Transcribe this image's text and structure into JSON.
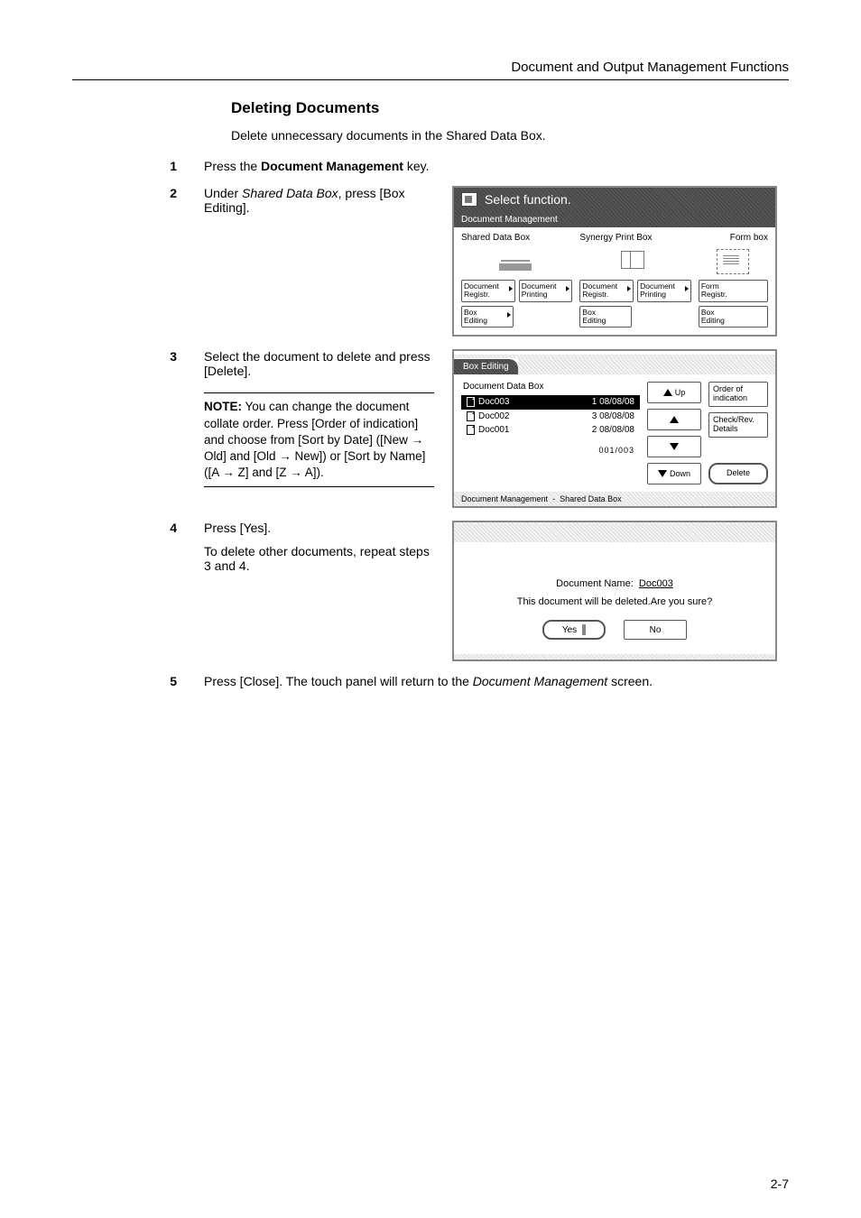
{
  "header": "Document and Output Management Functions",
  "title": "Deleting Documents",
  "intro": "Delete unnecessary documents in the Shared Data Box.",
  "steps": {
    "s1": {
      "n": "1",
      "pre": "Press the ",
      "bold": "Document Management",
      "post": " key."
    },
    "s2": {
      "n": "2",
      "pre": "Under ",
      "ital": "Shared Data Box",
      "post": ", press [Box Editing]."
    },
    "s3": {
      "n": "3",
      "text": "Select the document to delete and press [Delete]."
    },
    "s4": {
      "n": "4",
      "text": "Press [Yes].",
      "text2": "To delete other documents, repeat steps 3 and 4."
    },
    "s5": {
      "n": "5",
      "pre": "Press [Close]. The touch panel will return to the ",
      "ital": "Document Management",
      "post": " screen."
    }
  },
  "note": {
    "label": "NOTE:",
    "body": "You can change the document collate order. Press [Order of indication] and choose from [Sort by Date] ([New → Old] and [Old → New]) or [Sort by Name] ([A → Z] and [Z → A])."
  },
  "panel1": {
    "title": "Select function.",
    "sub": "Document Management",
    "col1": {
      "h": "Shared Data Box",
      "b1": "Document\nRegistr.",
      "b2": "Document\nPrinting",
      "b3": "Box\nEditing"
    },
    "col2": {
      "h": "Synergy Print Box",
      "b1": "Document\nRegistr.",
      "b2": "Document\nPrinting",
      "b3": "Box\nEditing"
    },
    "col3": {
      "h": "Form box",
      "b1": "Form\nRegistr.",
      "b3": "Box\nEditing"
    }
  },
  "panel2": {
    "tab": "Box Editing",
    "list_head": "Document Data Box",
    "rows": [
      {
        "name": "Doc003",
        "num": "1",
        "date": "08/08/08"
      },
      {
        "name": "Doc002",
        "num": "3",
        "date": "08/08/08"
      },
      {
        "name": "Doc001",
        "num": "2",
        "date": "08/08/08"
      }
    ],
    "counter": "001/003",
    "up": "Up",
    "down": "Down",
    "order": "Order of\nindication",
    "check": "Check/Rev.\nDetails",
    "delete": "Delete",
    "bc1": "Document Management",
    "bc2": "Shared Data Box"
  },
  "panel3": {
    "name_label": "Document Name:",
    "name_value": "Doc003",
    "msg": "This document will be deleted.Are you sure?",
    "yes": "Yes",
    "no": "No"
  },
  "page": "2-7"
}
